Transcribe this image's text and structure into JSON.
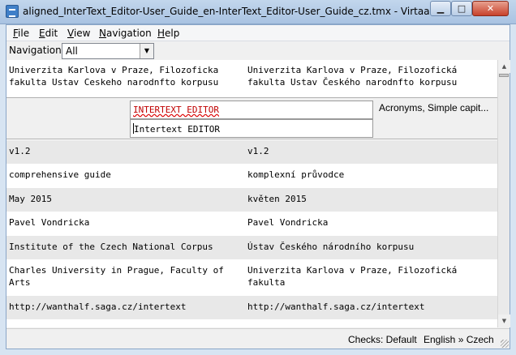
{
  "window": {
    "title": "aligned_InterText_Editor-User_Guide_en-InterText_Editor-User_Guide_cz.tmx - Virtaal",
    "minimize": "▁",
    "maximize": "□",
    "close": "✕"
  },
  "menu": [
    {
      "label": "File",
      "key": "F",
      "rest": "ile"
    },
    {
      "label": "Edit",
      "key": "E",
      "rest": "dit"
    },
    {
      "label": "View",
      "key": "V",
      "rest": "iew"
    },
    {
      "label": "Navigation",
      "key": "N",
      "rest": "avigation"
    },
    {
      "label": "Help",
      "key": "H",
      "rest": "elp"
    }
  ],
  "navigation": {
    "label": "Navigation:",
    "selected": "All"
  },
  "units": {
    "top": {
      "source": "Univerzita Karlova v Praze, Filozoficka fakulta Ustav Ceskeho narodnfto korpusu",
      "target": "Univerzita Karlova v Praze, Filozofická fakulta Ustav Českého narodnfto korpusu"
    },
    "current": {
      "source": "INTERTEXT EDITOR",
      "target": "Intertext EDITOR",
      "note": "Acronyms, Simple capit..."
    },
    "list": [
      {
        "source": "v1.2",
        "target": "v1.2"
      },
      {
        "source": "comprehensive guide",
        "target": "komplexní průvodce"
      },
      {
        "source": "May 2015",
        "target": "květen 2015"
      },
      {
        "source": "Pavel Vondricka",
        "target": "Pavel Vondricka"
      },
      {
        "source": "Institute of the Czech National Corpus",
        "target": "Ústav Českého národního korpusu"
      },
      {
        "source": "Charles University in Prague, Faculty of Arts",
        "target": "Univerzita Karlova v Praze, Filozofická fakulta"
      },
      {
        "source": "http://wanthalf.saga.cz/intertext",
        "target": "http://wanthalf.saga.cz/intertext"
      }
    ]
  },
  "status": {
    "checks": "Checks: Default",
    "languages": "English » Czech"
  },
  "icons": {
    "app": "virtaal-app-icon",
    "dropdown": "chevron-down-icon",
    "scroll_up": "arrow-up-icon",
    "scroll_down": "arrow-down-icon",
    "grip": "resize-grip-icon"
  }
}
